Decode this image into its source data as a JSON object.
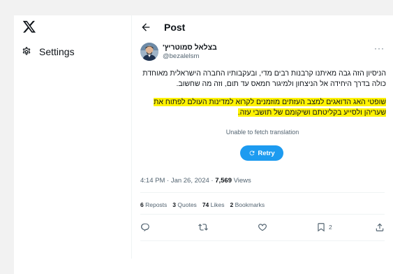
{
  "nav": {
    "settings_label": "Settings"
  },
  "header": {
    "title": "Post"
  },
  "tweet": {
    "author_name": "בצלאל סמוטריץ'",
    "author_handle": "@bezalelsm",
    "paragraph1": "הניסיון הזה גבה מאיתנו קרבנות רבים מדי, ובעקבותיו החברה הישראלית מאוחדת כולה בדרך היחידה אל הניצחון ולמיגור חמאס עד תום, וזה מה שחשוב.",
    "paragraph2": "שופטי האג הדואגים למצב העזתים מוזמנים לקרוא למדינות העולם לפתוח את שעריהן ולסייע בקליטתם ושיקומם של תושבי עזה."
  },
  "translation": {
    "message": "Unable to fetch translation",
    "retry_label": "Retry"
  },
  "meta": {
    "time": "4:14 PM · Jan 26, 2024 · ",
    "views_count": "7,569",
    "views_label": " Views"
  },
  "stats": {
    "reposts_count": "6",
    "reposts_label": "Reposts",
    "quotes_count": "3",
    "quotes_label": "Quotes",
    "likes_count": "74",
    "likes_label": "Likes",
    "bookmarks_count": "2",
    "bookmarks_label": "Bookmarks"
  },
  "actions": {
    "bookmark_count": "2"
  },
  "colors": {
    "accent": "#1d9bf0",
    "highlight": "#fff200",
    "secondary_text": "#536471"
  }
}
